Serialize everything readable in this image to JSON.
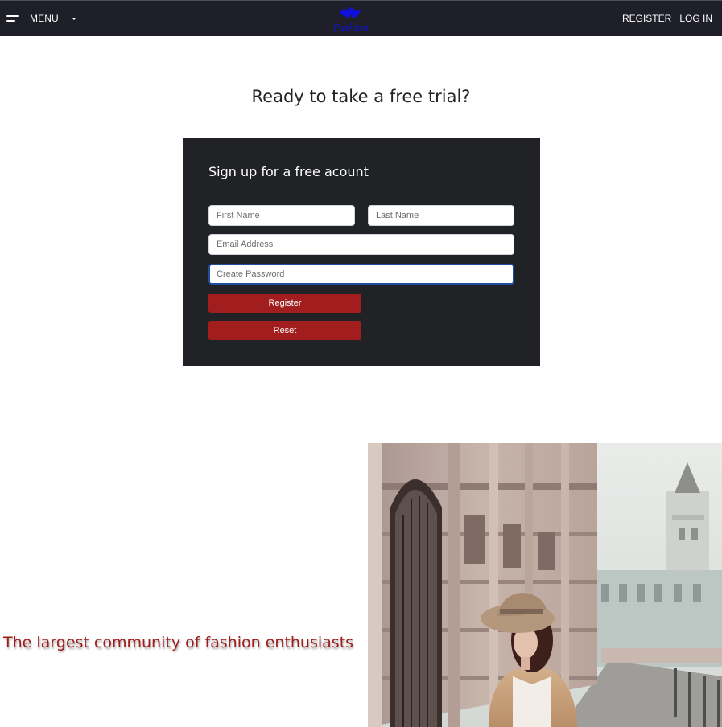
{
  "nav": {
    "menu_label": "MENU",
    "register_label": "REGISTER",
    "login_label": "LOG IN",
    "logo_text": "Fashion"
  },
  "hero": {
    "title": "Ready to take a free trial?"
  },
  "signup": {
    "title": "Sign up for a free acount",
    "first_name_placeholder": "First Name",
    "last_name_placeholder": "Last Name",
    "email_placeholder": "Email Address",
    "password_placeholder": "Create Password",
    "register_label": "Register",
    "reset_label": "Reset"
  },
  "promo": {
    "tagline": "The largest community of fashion enthusiasts"
  },
  "colors": {
    "navbar": "#1e1f29",
    "card": "#202226",
    "accent_red": "#a21e1e",
    "tagline": "#a11b1b",
    "logo": "#1010dd"
  }
}
